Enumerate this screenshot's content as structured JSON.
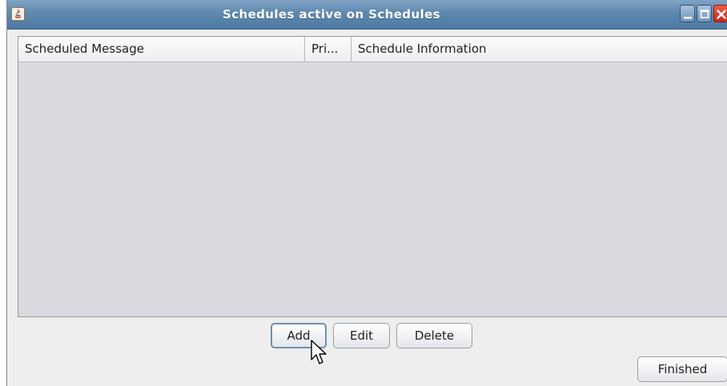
{
  "window": {
    "title_prefix": "Schedules ",
    "title_mid": "activ",
    "title_suffix": "e on Schedules",
    "app_icon": "java-icon",
    "controls": {
      "minimize_icon": "minimize-icon",
      "maximize_icon": "maximize-icon",
      "close_icon": "close-icon"
    }
  },
  "table": {
    "columns": [
      "Scheduled Message",
      "Pri...",
      "Schedule Information"
    ],
    "rows": []
  },
  "buttons": {
    "add": "Add",
    "edit": "Edit",
    "delete": "Delete",
    "finished": "Finished"
  },
  "colors": {
    "titlebar": "#5f88ae",
    "close": "#d9342a",
    "table_bg": "#d8dae0"
  }
}
